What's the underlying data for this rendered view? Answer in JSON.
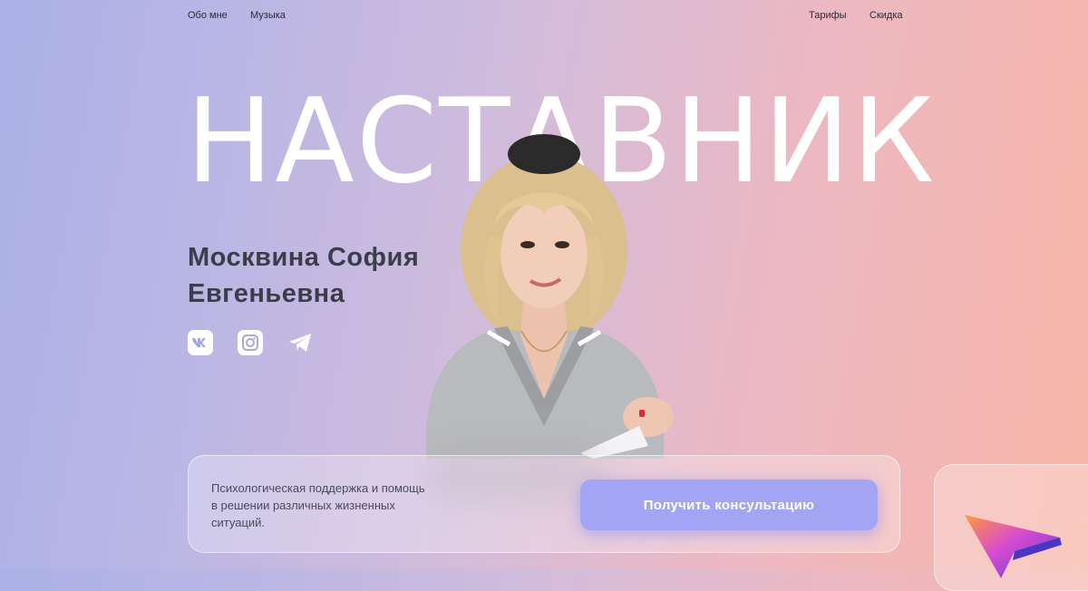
{
  "nav": {
    "left": [
      {
        "label": "Обо мне",
        "icon": null
      },
      {
        "label": "Музыка",
        "icon": null
      }
    ],
    "right": [
      {
        "label": "Тарифы",
        "icon": null
      },
      {
        "label": "Скидка",
        "icon": null
      }
    ]
  },
  "hero": {
    "title": "НАСТАВНИК",
    "name_line1": "Москвина София",
    "name_line2": "Евгеньевна"
  },
  "social": [
    {
      "name": "vk",
      "icon": "vk-icon"
    },
    {
      "name": "instagram",
      "icon": "instagram-icon"
    },
    {
      "name": "telegram",
      "icon": "telegram-icon"
    }
  ],
  "panel": {
    "description": "Психологическая поддержка и помощь в решении различных жизненных ситуаций.",
    "cta_label": "Получить консультацию"
  },
  "colors": {
    "gradient_left": "#aab1e6",
    "gradient_right": "#f8b5a6",
    "cta": "#a4a4f5",
    "text_dark": "#3c3c4a"
  },
  "decor": {
    "side_icon": "paper-plane-3d-icon"
  }
}
